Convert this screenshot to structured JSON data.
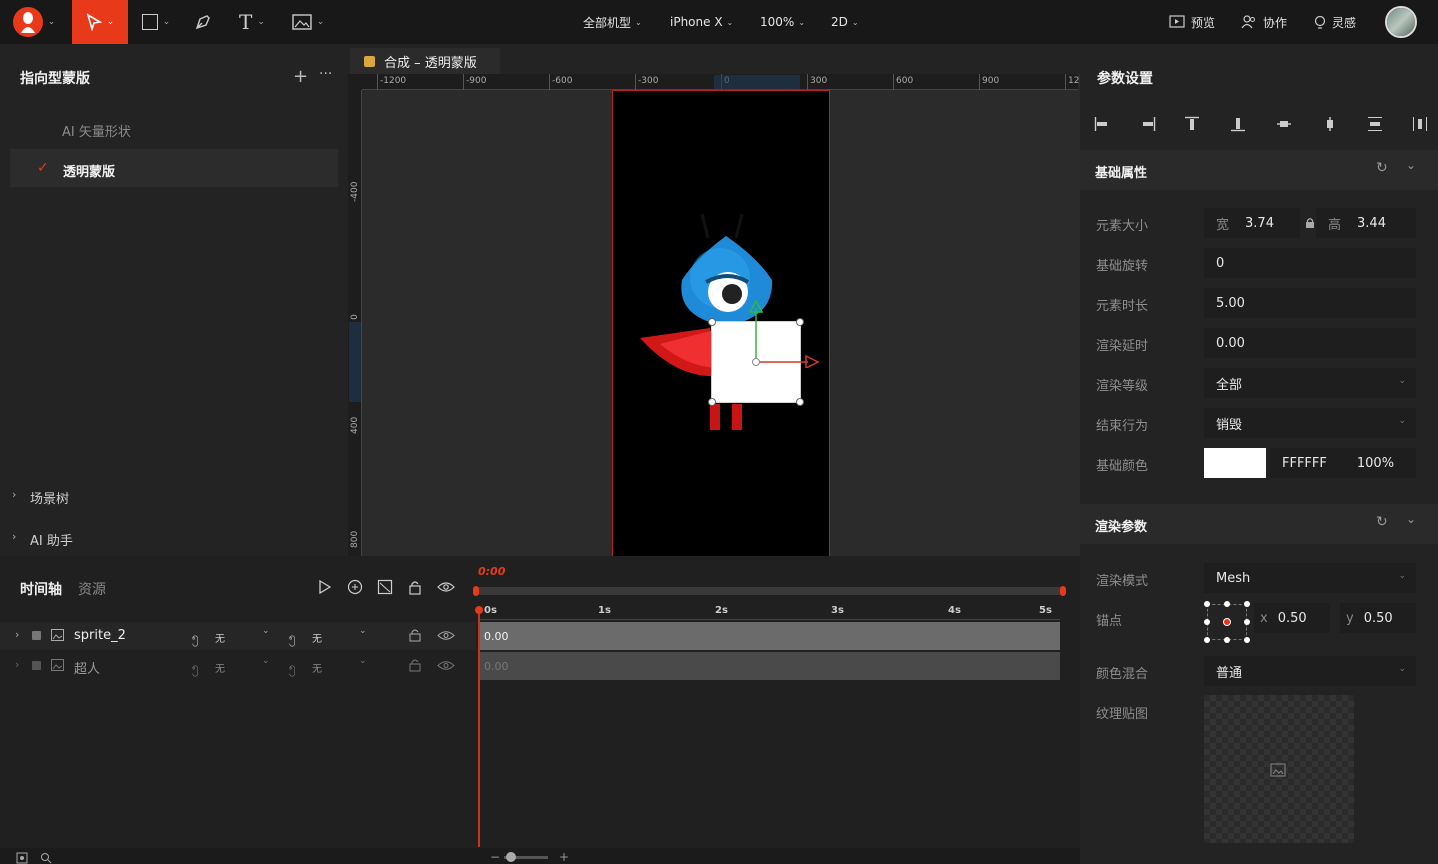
{
  "topbar": {
    "device_menu": "全部机型",
    "model_menu": "iPhone X",
    "zoom_menu": "100%",
    "mode_menu": "2D",
    "preview": "预览",
    "collab": "协作",
    "inspire": "灵感"
  },
  "left": {
    "title": "指向型蒙版",
    "items": [
      {
        "label": "AI 矢量形状"
      },
      {
        "label": "透明蒙版"
      }
    ],
    "scene_tree": "场景树",
    "ai_helper": "AI 助手"
  },
  "canvas": {
    "tab_title": "合成 – 透明蒙版",
    "ruler_h": [
      "-1200",
      "-900",
      "-600",
      "-300",
      "0",
      "300",
      "600",
      "900",
      "12"
    ],
    "ruler_v": [
      "-400",
      "0",
      "400",
      "800"
    ]
  },
  "timeline": {
    "tab_timeline": "时间轴",
    "tab_assets": "资源",
    "playhead": "0:00",
    "ticks": [
      "0s",
      "1s",
      "2s",
      "3s",
      "4s",
      "5s"
    ],
    "layers": [
      {
        "name": "sprite_2",
        "mode1": "无",
        "mode2": "无",
        "start": "0.00"
      },
      {
        "name": "超人",
        "mode1": "无",
        "mode2": "无",
        "start": "0.00"
      }
    ]
  },
  "right": {
    "title": "参数设置",
    "basic_title": "基础属性",
    "size_label": "元素大小",
    "width_label": "宽",
    "width_value": "3.74",
    "height_label": "高",
    "height_value": "3.44",
    "rotation_label": "基础旋转",
    "rotation_value": "0",
    "duration_label": "元素时长",
    "duration_value": "5.00",
    "delay_label": "渲染延时",
    "delay_value": "0.00",
    "level_label": "渲染等级",
    "level_value": "全部",
    "end_label": "结束行为",
    "end_value": "销毁",
    "color_label": "基础颜色",
    "color_hex": "FFFFFF",
    "color_alpha": "100%",
    "color_swatch": "#ffffff",
    "render_title": "渲染参数",
    "render_mode_label": "渲染模式",
    "render_mode_value": "Mesh",
    "anchor_label": "锚点",
    "anchor_x_label": "x",
    "anchor_x": "0.50",
    "anchor_y_label": "y",
    "anchor_y": "0.50",
    "blend_label": "颜色混合",
    "blend_value": "普通",
    "texture_label": "纹理贴图"
  },
  "colors": {
    "accent": "#e8391a",
    "selection": "#ffffff"
  }
}
